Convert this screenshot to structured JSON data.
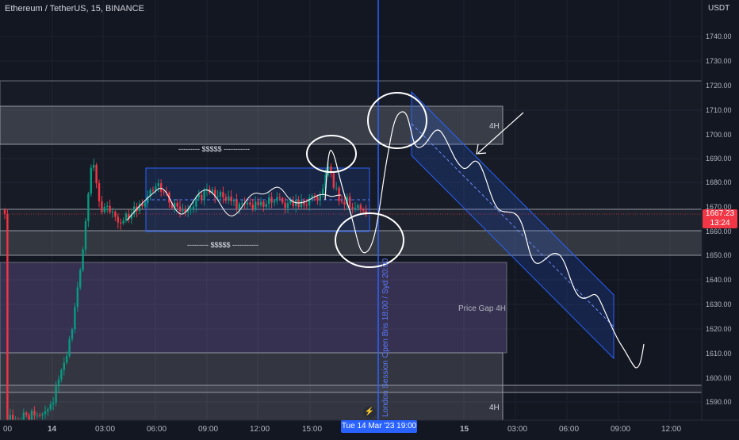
{
  "header": {
    "symbol": "Ethereum / TetherUS, 15, BINANCE",
    "currency": "USDT"
  },
  "price_axis": {
    "labels": [
      "1740.00",
      "1730.00",
      "1720.00",
      "1710.00",
      "1700.00",
      "1690.00",
      "1680.00",
      "1670.00",
      "1660.00",
      "1650.00",
      "1640.00",
      "1630.00",
      "1620.00",
      "1610.00",
      "1600.00",
      "1590.00"
    ],
    "last_price": "1667.23",
    "countdown": "13:24"
  },
  "time_axis": {
    "labels": [
      "00",
      "14",
      "03:00",
      "06:00",
      "09:00",
      "12:00",
      "15:00",
      "19:00",
      "15",
      "03:00",
      "06:00",
      "09:00",
      "12:00"
    ],
    "hover_label": "Tue 14 Mar '23   19:00"
  },
  "annotations": {
    "zone_upper": "4H",
    "zone_lower": "4H",
    "price_gap": "Price Gap 4H",
    "liquidity_top": "--------- $$$$$ -----------",
    "liquidity_bottom": "--------- $$$$$ -----------",
    "session_line": "London Session Open Bris 18:00 / Syd 20:00"
  },
  "colors": {
    "up": "#089981",
    "down": "#f23645",
    "channel": "#2962ff",
    "session": "#2962ff"
  },
  "chart_data": {
    "type": "candlestick",
    "symbol": "ETHUSDT",
    "interval": "15",
    "ylim": [
      1588,
      1752
    ],
    "zones": [
      {
        "label": "4H",
        "from": 1696,
        "to": 1711
      },
      {
        "label": "",
        "from": 1650,
        "to": 1660
      },
      {
        "label": "Price Gap 4H",
        "from": 1610,
        "to": 1647
      },
      {
        "label": "4H",
        "from": 1584,
        "to": 1600
      }
    ],
    "last_price": 1667.23
  }
}
